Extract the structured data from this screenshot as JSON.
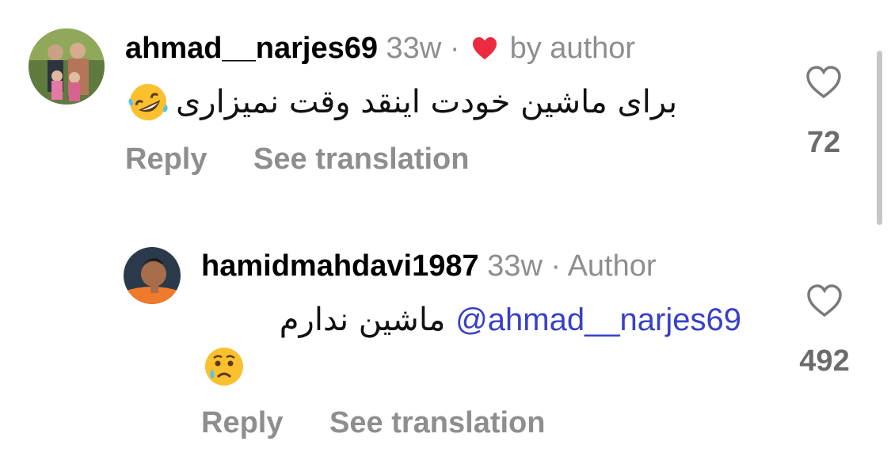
{
  "comments": [
    {
      "username": "ahmad__narjes69",
      "time": "33w",
      "separator": "·",
      "badge": "by author",
      "badge_icon": "red-heart-icon",
      "text": "برای ماشین خودت اینقد وقت نمیزاری",
      "emoji": "rolling-on-floor-laughing-emoji",
      "actions": {
        "reply": "Reply",
        "translate": "See translation"
      },
      "likes": "72"
    },
    {
      "username": "hamidmahdavi1987",
      "time": "33w",
      "separator": "·",
      "badge": "Author",
      "mention": "@ahmad__narjes69",
      "text": "ماشین ندارم",
      "emoji": "crying-face-emoji",
      "actions": {
        "reply": "Reply",
        "translate": "See translation"
      },
      "likes": "492"
    }
  ],
  "colors": {
    "heart_red": "#ed2a3f",
    "mention_blue": "#3840c8",
    "muted_gray": "#8e8e8e"
  }
}
